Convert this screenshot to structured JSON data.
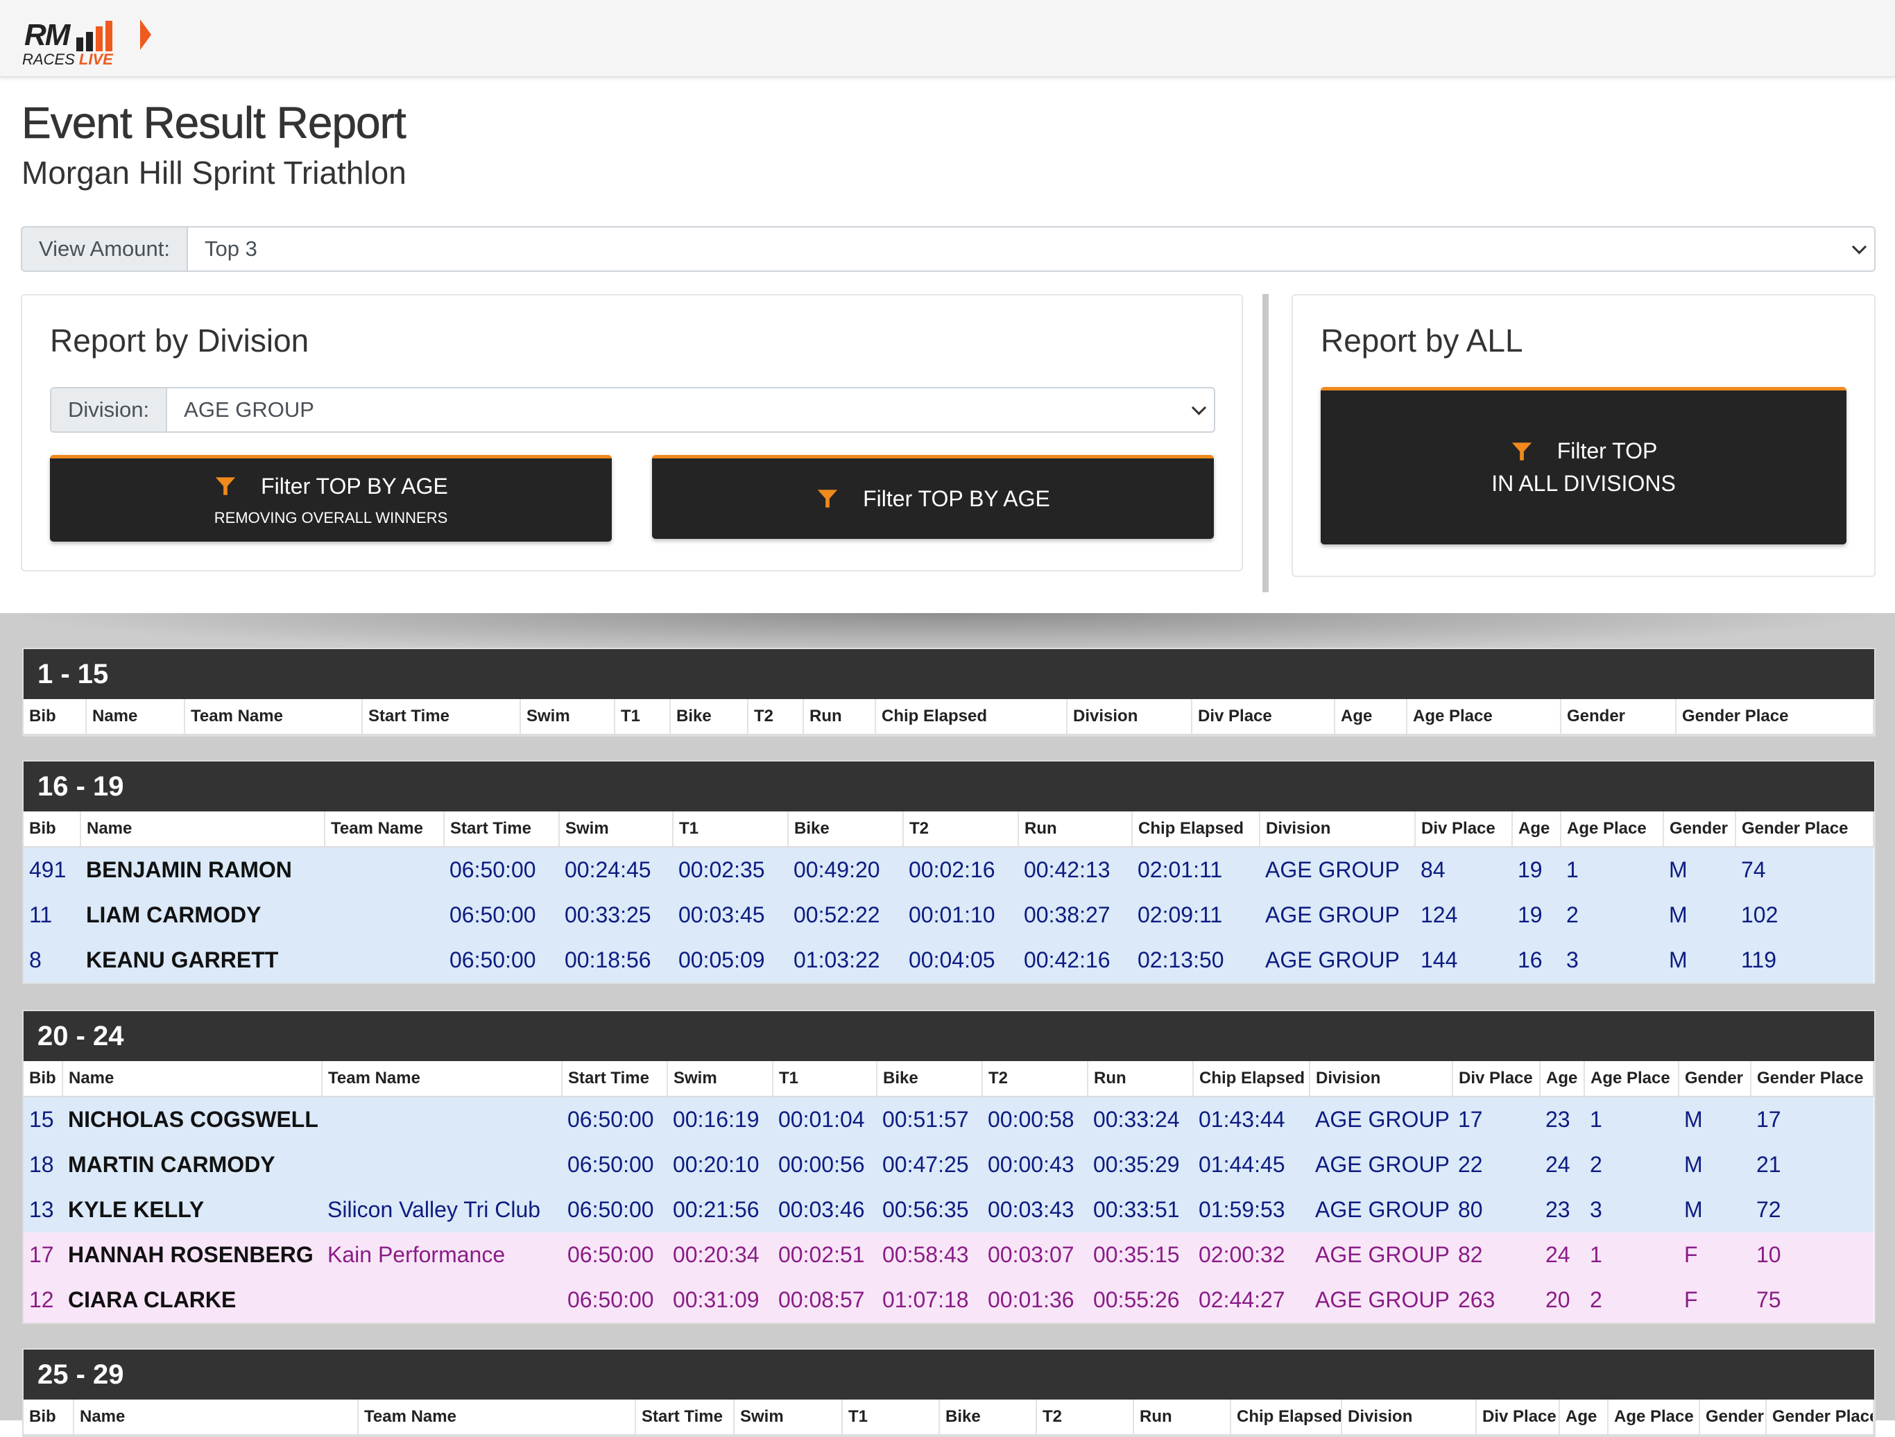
{
  "app": {
    "logo_rm": "RM",
    "logo_races": "RACES",
    "logo_live": "LIVE"
  },
  "header": {
    "title": "Event Result Report",
    "subtitle": "Morgan Hill Sprint Triathlon"
  },
  "view_amount": {
    "label": "View Amount:",
    "value": "Top 3"
  },
  "division_panel": {
    "title": "Report by Division",
    "division_label": "Division:",
    "division_value": "AGE GROUP",
    "btn1_label": "Filter TOP BY AGE",
    "btn1_sub": "REMOVING OVERALL WINNERS",
    "btn2_label": "Filter TOP BY AGE"
  },
  "all_panel": {
    "title": "Report by ALL",
    "btn_line1": "Filter TOP",
    "btn_line2": "IN ALL DIVISIONS"
  },
  "colors": {
    "accent": "#f08a1d",
    "dark": "#333333",
    "male_row": "#dbe9f8",
    "female_row": "#f8e6f8"
  },
  "columns": [
    "Bib",
    "Name",
    "Team Name",
    "Start Time",
    "Swim",
    "T1",
    "Bike",
    "T2",
    "Run",
    "Chip Elapsed",
    "Division",
    "Div Place",
    "Age",
    "Age Place",
    "Gender",
    "Gender Place"
  ],
  "sections": [
    {
      "title": "1 - 15",
      "rows": []
    },
    {
      "title": "16 - 19",
      "rows": [
        {
          "g": "M",
          "cells": [
            "491",
            "BENJAMIN RAMON",
            "",
            "06:50:00",
            "00:24:45",
            "00:02:35",
            "00:49:20",
            "00:02:16",
            "00:42:13",
            "02:01:11",
            "AGE GROUP",
            "84",
            "19",
            "1",
            "M",
            "74"
          ]
        },
        {
          "g": "M",
          "cells": [
            "11",
            "LIAM CARMODY",
            "",
            "06:50:00",
            "00:33:25",
            "00:03:45",
            "00:52:22",
            "00:01:10",
            "00:38:27",
            "02:09:11",
            "AGE GROUP",
            "124",
            "19",
            "2",
            "M",
            "102"
          ]
        },
        {
          "g": "M",
          "cells": [
            "8",
            "KEANU GARRETT",
            "",
            "06:50:00",
            "00:18:56",
            "00:05:09",
            "01:03:22",
            "00:04:05",
            "00:42:16",
            "02:13:50",
            "AGE GROUP",
            "144",
            "16",
            "3",
            "M",
            "119"
          ]
        }
      ]
    },
    {
      "title": "20 - 24",
      "rows": [
        {
          "g": "M",
          "cells": [
            "15",
            "NICHOLAS COGSWELL",
            "",
            "06:50:00",
            "00:16:19",
            "00:01:04",
            "00:51:57",
            "00:00:58",
            "00:33:24",
            "01:43:44",
            "AGE GROUP",
            "17",
            "23",
            "1",
            "M",
            "17"
          ]
        },
        {
          "g": "M",
          "cells": [
            "18",
            "MARTIN CARMODY",
            "",
            "06:50:00",
            "00:20:10",
            "00:00:56",
            "00:47:25",
            "00:00:43",
            "00:35:29",
            "01:44:45",
            "AGE GROUP",
            "22",
            "24",
            "2",
            "M",
            "21"
          ]
        },
        {
          "g": "M",
          "cells": [
            "13",
            "KYLE KELLY",
            "Silicon Valley Tri Club",
            "06:50:00",
            "00:21:56",
            "00:03:46",
            "00:56:35",
            "00:03:43",
            "00:33:51",
            "01:59:53",
            "AGE GROUP",
            "80",
            "23",
            "3",
            "M",
            "72"
          ]
        },
        {
          "g": "F",
          "cells": [
            "17",
            "HANNAH ROSENBERG",
            "Kain Performance",
            "06:50:00",
            "00:20:34",
            "00:02:51",
            "00:58:43",
            "00:03:07",
            "00:35:15",
            "02:00:32",
            "AGE GROUP",
            "82",
            "24",
            "1",
            "F",
            "10"
          ]
        },
        {
          "g": "F",
          "cells": [
            "12",
            "CIARA CLARKE",
            "",
            "06:50:00",
            "00:31:09",
            "00:08:57",
            "01:07:18",
            "00:01:36",
            "00:55:26",
            "02:44:27",
            "AGE GROUP",
            "263",
            "20",
            "2",
            "F",
            "75"
          ]
        }
      ]
    },
    {
      "title": "25 - 29",
      "rows": []
    }
  ]
}
